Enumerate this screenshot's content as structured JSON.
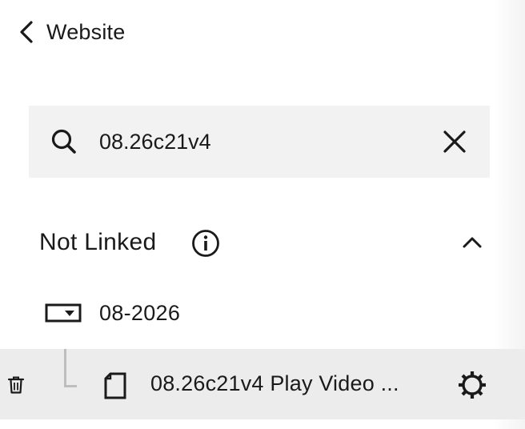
{
  "header": {
    "back_label": "Website",
    "back_icon": "chevron-left-icon"
  },
  "search": {
    "value": "08.26c21v4",
    "placeholder": "",
    "search_icon": "search-icon",
    "clear_icon": "close-icon"
  },
  "section": {
    "title": "Not Linked",
    "info_icon": "info-icon",
    "collapse_icon": "chevron-up-icon",
    "expanded": true
  },
  "folder": {
    "label": "08-2026",
    "icon": "folder-dropdown-icon"
  },
  "file": {
    "label": "08.26c21v4 Play Video ...",
    "icon": "file-icon",
    "delete_icon": "trash-icon",
    "settings_icon": "gear-icon",
    "selected": true
  },
  "colors": {
    "background": "#ffffff",
    "search_background": "#f2f2f2",
    "selected_row": "#ececec",
    "text": "#1a1a1a",
    "connector": "#bdbdbd"
  }
}
